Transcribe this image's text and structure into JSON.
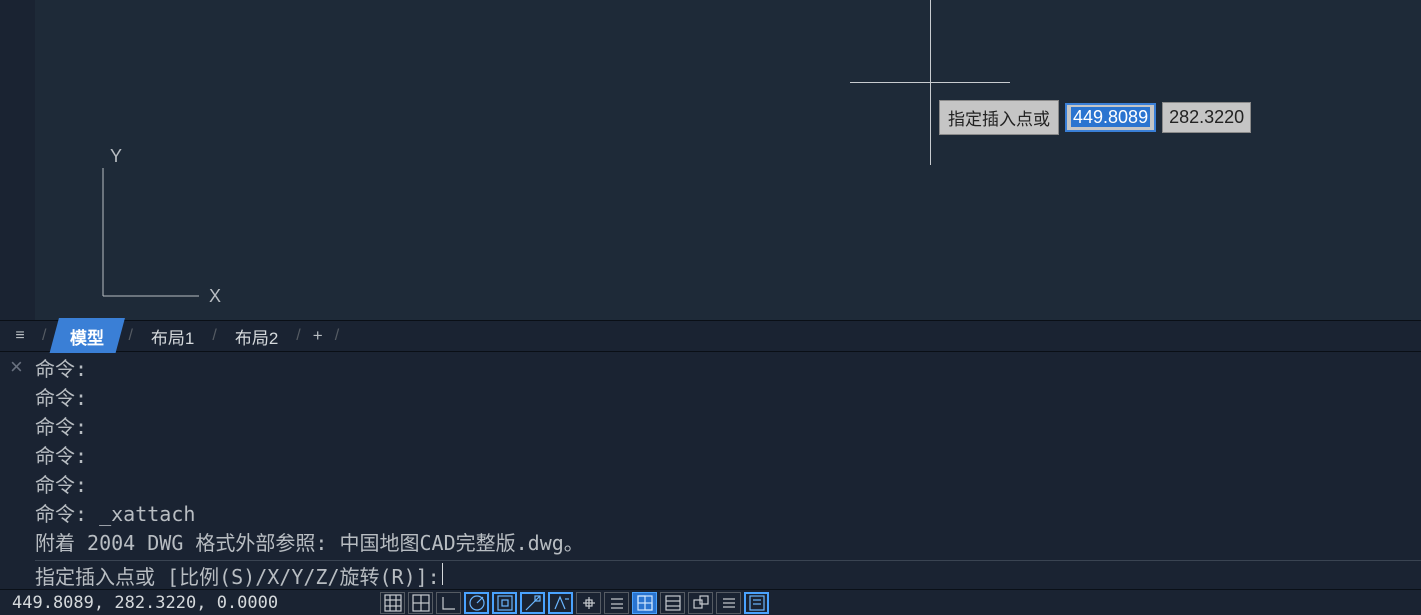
{
  "crosshair_tooltip": {
    "prompt": "指定插入点或",
    "x": "449.8089",
    "y": "282.3220"
  },
  "ucs": {
    "x_label": "X",
    "y_label": "Y"
  },
  "tabs": {
    "model": "模型",
    "layout1": "布局1",
    "layout2": "布局2",
    "add": "+",
    "sep": "/"
  },
  "cmd": {
    "lines": [
      "命令:",
      "命令:",
      "命令:",
      "命令:",
      "命令:",
      "命令: _xattach",
      "附着 2004 DWG 格式外部参照: 中国地图CAD完整版.dwg。"
    ],
    "input": "指定插入点或 [比例(S)/X/Y/Z/旋转(R)]: "
  },
  "status": {
    "coords": "449.8089, 282.3220, 0.0000"
  }
}
